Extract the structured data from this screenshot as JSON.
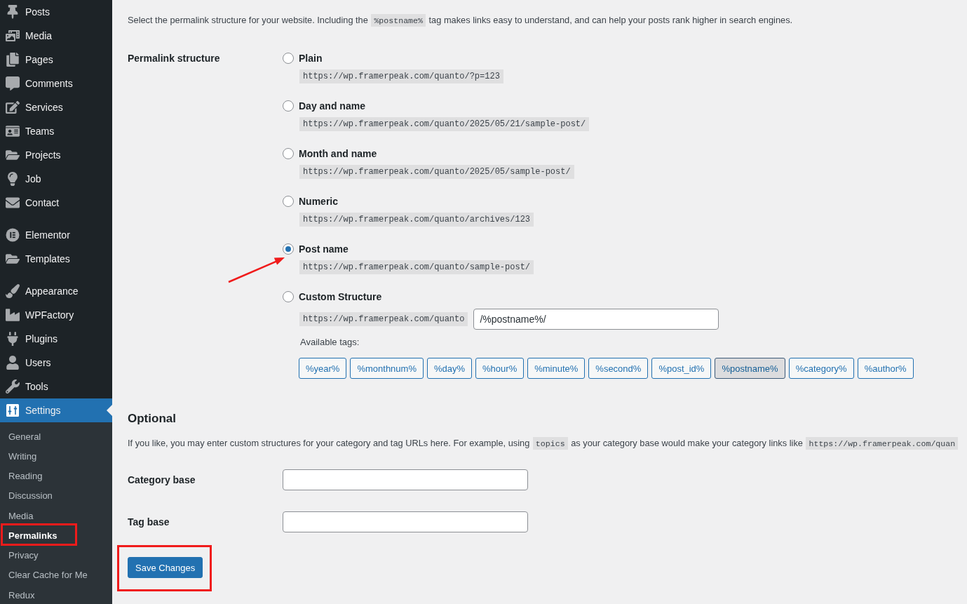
{
  "sidebar": {
    "sections": [
      {
        "items": [
          {
            "label": "Posts",
            "selected": false
          },
          {
            "label": "Media",
            "selected": false
          },
          {
            "label": "Pages",
            "selected": false
          },
          {
            "label": "Comments",
            "selected": false
          },
          {
            "label": "Services",
            "selected": false
          },
          {
            "label": "Teams",
            "selected": false
          },
          {
            "label": "Projects",
            "selected": false
          },
          {
            "label": "Job",
            "selected": false
          },
          {
            "label": "Contact",
            "selected": false
          }
        ]
      },
      {
        "items": [
          {
            "label": "Elementor",
            "selected": false
          },
          {
            "label": "Templates",
            "selected": false
          }
        ]
      },
      {
        "items": [
          {
            "label": "Appearance",
            "selected": false
          },
          {
            "label": "WPFactory",
            "selected": false
          },
          {
            "label": "Plugins",
            "selected": false
          },
          {
            "label": "Users",
            "selected": false
          },
          {
            "label": "Tools",
            "selected": false
          },
          {
            "label": "Settings",
            "selected": true,
            "submenu": [
              {
                "label": "General",
                "selected": false
              },
              {
                "label": "Writing",
                "selected": false
              },
              {
                "label": "Reading",
                "selected": false
              },
              {
                "label": "Discussion",
                "selected": false
              },
              {
                "label": "Media",
                "selected": false
              },
              {
                "label": "Permalinks",
                "selected": true
              },
              {
                "label": "Privacy",
                "selected": false
              },
              {
                "label": "Clear Cache for Me",
                "selected": false
              },
              {
                "label": "Redux",
                "selected": false
              }
            ]
          }
        ]
      }
    ]
  },
  "permalinks": {
    "description": [
      {
        "kind": "text",
        "text": "Select the permalink structure for your website. Including the"
      },
      {
        "kind": "code",
        "text": "%postname%"
      },
      {
        "kind": "text",
        "text": "tag makes links easy to understand, and can help your posts rank higher in search engines."
      }
    ],
    "structure": {
      "label": "Permalink structure",
      "options": [
        {
          "kind": "preset",
          "label": "Plain",
          "example": "https://wp.framerpeak.com/quanto/?p=123",
          "selected": false
        },
        {
          "kind": "preset",
          "label": "Day and name",
          "example": "https://wp.framerpeak.com/quanto/2025/05/21/sample-post/",
          "selected": false
        },
        {
          "kind": "preset",
          "label": "Month and name",
          "example": "https://wp.framerpeak.com/quanto/2025/05/sample-post/",
          "selected": false
        },
        {
          "kind": "preset",
          "label": "Numeric",
          "example": "https://wp.framerpeak.com/quanto/archives/123",
          "selected": false
        },
        {
          "kind": "preset",
          "label": "Post name",
          "example": "https://wp.framerpeak.com/quanto/sample-post/",
          "selected": true
        },
        {
          "kind": "custom",
          "label": "Custom Structure",
          "selected": false,
          "prefix": "https://wp.framerpeak.com/quanto",
          "value": "/%postname%/",
          "tags_label": "Available tags:",
          "tags": [
            {
              "label": "%year%",
              "selected": false
            },
            {
              "label": "%monthnum%",
              "selected": false
            },
            {
              "label": "%day%",
              "selected": false
            },
            {
              "label": "%hour%",
              "selected": false
            },
            {
              "label": "%minute%",
              "selected": false
            },
            {
              "label": "%second%",
              "selected": false
            },
            {
              "label": "%post_id%",
              "selected": false
            },
            {
              "label": "%postname%",
              "selected": true
            },
            {
              "label": "%category%",
              "selected": false
            },
            {
              "label": "%author%",
              "selected": false
            }
          ]
        }
      ]
    }
  },
  "optional": {
    "title": "Optional",
    "description": [
      {
        "kind": "text",
        "text": "If you like, you may enter custom structures for your category and tag URLs here. For example, using"
      },
      {
        "kind": "code",
        "text": "topics"
      },
      {
        "kind": "text",
        "text": "as your category base would make your category links like"
      },
      {
        "kind": "code",
        "text": "https://wp.framerpeak.com/quan"
      }
    ],
    "fields": [
      {
        "label": "Category base"
      },
      {
        "label": "Tag base"
      }
    ]
  },
  "save_button": {
    "label": "Save Changes"
  }
}
